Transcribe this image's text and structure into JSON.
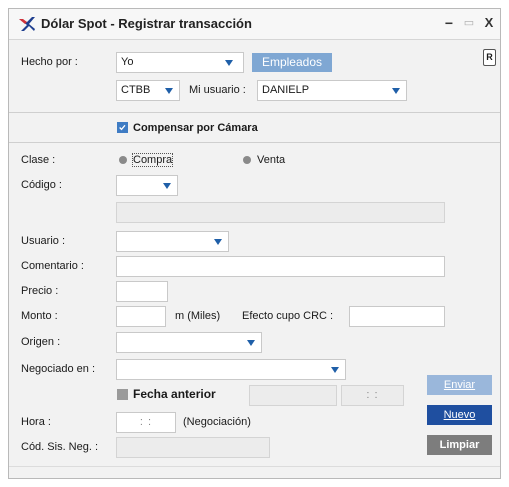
{
  "window": {
    "title": "Dólar Spot - Registrar transacción",
    "minimize_glyph": "−",
    "maximize_glyph": "▭",
    "close_glyph": "X"
  },
  "header": {
    "hecho_por_label": "Hecho por :",
    "hecho_por_value": "Yo",
    "empleados_label": "Empleados",
    "cuenta_value": "CTBB",
    "mi_usuario_label": "Mi usuario :",
    "mi_usuario_value": "DANIELP",
    "report_icon_glyph": "R"
  },
  "compensar": {
    "label": "Compensar por Cámara",
    "checked": true
  },
  "form": {
    "clase_label": "Clase :",
    "compra_label": "Compra",
    "venta_label": "Venta",
    "codigo_label": "Código :",
    "codigo_value": "",
    "descripcion_value": "",
    "usuario_label": "Usuario :",
    "usuario_value": "",
    "comentario_label": "Comentario :",
    "comentario_value": "",
    "precio_label": "Precio :",
    "precio_value": "",
    "monto_label": "Monto :",
    "monto_value": "",
    "monto_unit": "m (Miles)",
    "efecto_label": "Efecto cupo CRC :",
    "efecto_value": "",
    "origen_label": "Origen :",
    "origen_value": "",
    "negociado_label": "Negociado en :",
    "negociado_value": "",
    "fecha_anterior_label": "Fecha anterior",
    "fecha_value": "",
    "fecha_time_value": ": :",
    "hora_label": "Hora :",
    "hora_value": ": :",
    "hora_note": "(Negociación)",
    "cod_sis_label": "Cód. Sis. Neg. :",
    "cod_sis_value": ""
  },
  "buttons": {
    "enviar": "Enviar",
    "nuevo": "Nuevo",
    "limpiar": "Limpiar"
  },
  "colors": {
    "accent_blue": "#1f5fa8",
    "empleados_bg": "#7fa7d3",
    "nuevo_bg": "#1f4fa0",
    "enviar_bg": "#9ab7db",
    "limpiar_bg": "#7d7d7d"
  }
}
